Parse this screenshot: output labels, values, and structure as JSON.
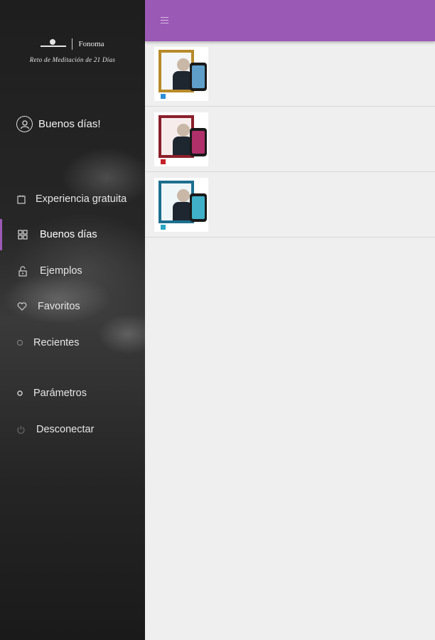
{
  "brand": {
    "logo_text": "Fonoma",
    "tagline": "Reto de Meditación de 21 Días"
  },
  "greeting": "Buenos días!",
  "nav": [
    {
      "label": "Experiencia gratuita",
      "icon": "calendar-icon"
    },
    {
      "label": "Buenos días",
      "icon": "grid-icon"
    },
    {
      "label": "Ejemplos",
      "icon": "unlock-icon"
    },
    {
      "label": "Favoritos",
      "icon": "heart-icon"
    },
    {
      "label": "Recientes",
      "icon": "clock-icon"
    },
    {
      "label": "Parámetros",
      "icon": "settings-icon"
    },
    {
      "label": "Desconectar",
      "icon": "power-icon"
    }
  ],
  "active_nav": "Buenos días",
  "topbar": {
    "menu_icon": "hamburger-icon",
    "color": "#9b59b6"
  },
  "items": [
    {
      "accent": "#2f8fd6",
      "frame_color": "#b88a2a",
      "screen_color": "#5f9ec9"
    },
    {
      "accent": "#c4212a",
      "frame_color": "#8a1f2a",
      "screen_color": "#b0306a"
    },
    {
      "accent": "#2aa6c4",
      "frame_color": "#1d6f8f",
      "screen_color": "#3fb0c8"
    }
  ]
}
